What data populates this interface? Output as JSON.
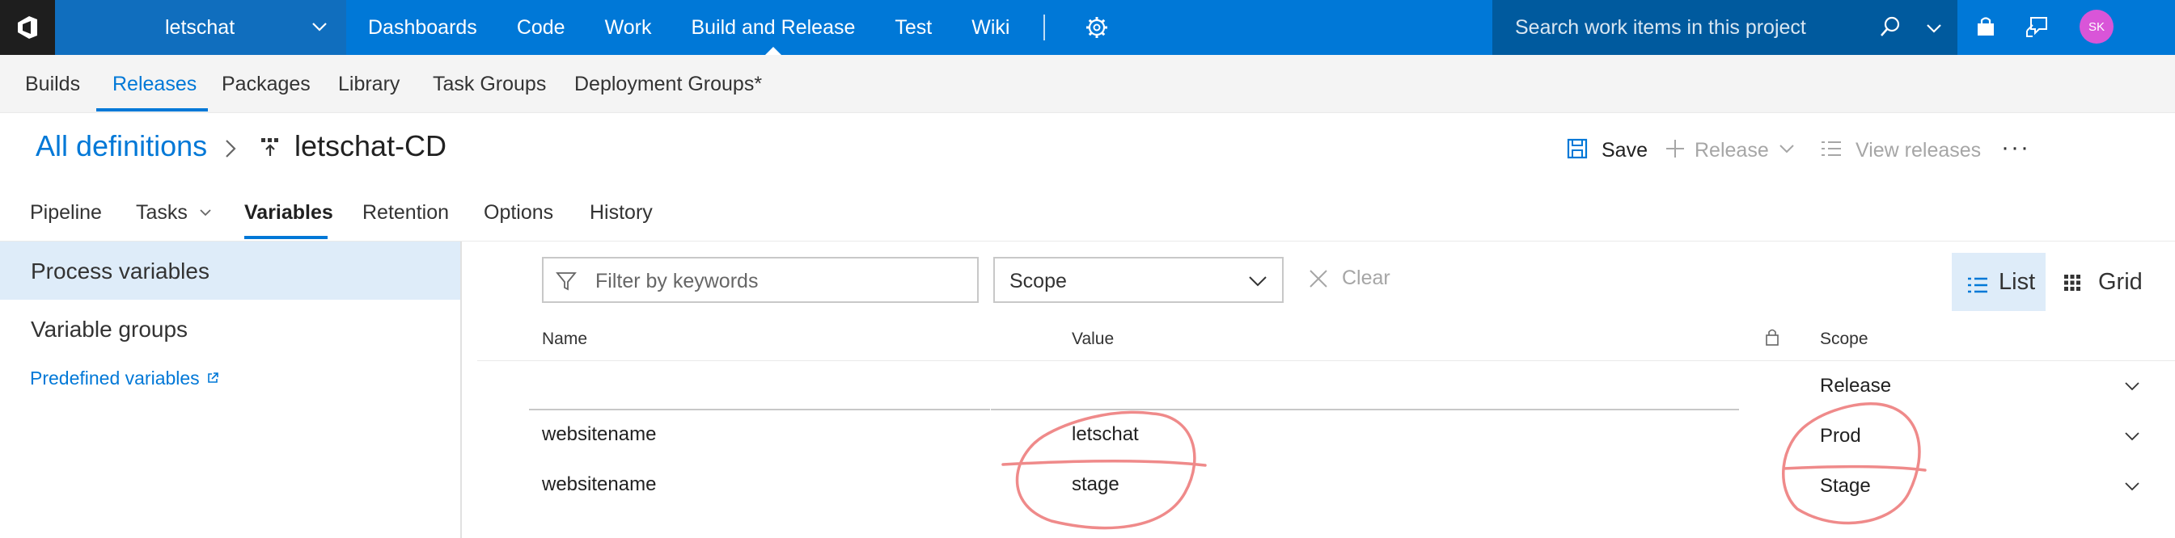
{
  "topbar": {
    "project": "letschat",
    "nav": [
      "Dashboards",
      "Code",
      "Work",
      "Build and Release",
      "Test",
      "Wiki"
    ],
    "active_nav": "Build and Release",
    "search_placeholder": "Search work items in this project",
    "avatar_initials": "SK"
  },
  "hubs": {
    "items": [
      "Builds",
      "Releases",
      "Packages",
      "Library",
      "Task Groups",
      "Deployment Groups*"
    ],
    "active": "Releases"
  },
  "header": {
    "breadcrumb": "All definitions",
    "title": "letschat-CD",
    "save": "Save",
    "release": "Release",
    "view_releases": "View releases"
  },
  "tabs": {
    "items": [
      "Pipeline",
      "Tasks",
      "Variables",
      "Retention",
      "Options",
      "History"
    ],
    "active": "Variables"
  },
  "left_panel": {
    "process_variables": "Process variables",
    "variable_groups": "Variable groups",
    "predefined_variables": "Predefined variables"
  },
  "toolbar": {
    "filter_placeholder": "Filter by keywords",
    "scope": "Scope",
    "clear": "Clear",
    "list": "List",
    "grid": "Grid"
  },
  "grid": {
    "columns": {
      "name": "Name",
      "value": "Value",
      "scope": "Scope"
    },
    "rows": [
      {
        "name": "",
        "value": "",
        "scope": "Release"
      },
      {
        "name": "websitename",
        "value": "letschat",
        "scope": "Prod"
      },
      {
        "name": "websitename",
        "value": "stage",
        "scope": "Stage"
      }
    ]
  },
  "colors": {
    "accent": "#0078d7",
    "topbar": "#0078d7",
    "selected_bg": "#deecf9",
    "annotation": "#ef8a8a"
  }
}
